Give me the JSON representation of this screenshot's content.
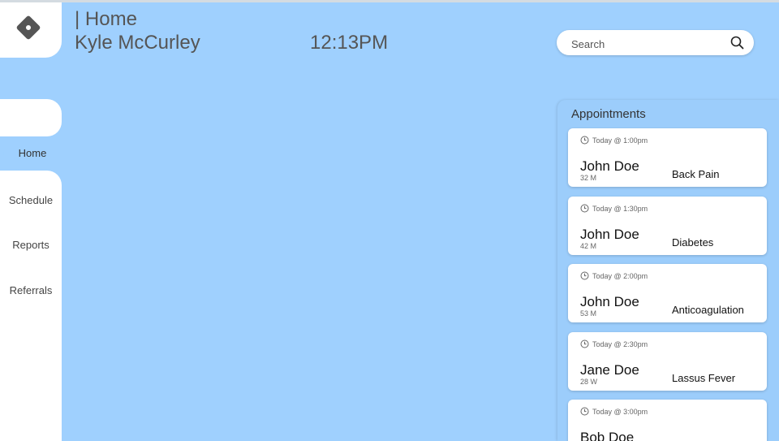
{
  "header": {
    "title": "| Home",
    "user": "Kyle McCurley",
    "time": "12:13PM"
  },
  "search": {
    "placeholder": "Search",
    "icon": "search-icon"
  },
  "sidebar": {
    "items": [
      {
        "label": "Home",
        "active": true
      },
      {
        "label": "Schedule",
        "active": false
      },
      {
        "label": "Reports",
        "active": false
      },
      {
        "label": "Referrals",
        "active": false
      }
    ]
  },
  "appointments": {
    "title": "Appointments",
    "items": [
      {
        "time": "Today @ 1:00pm",
        "name": "John Doe",
        "meta": "32 M",
        "reason": "Back Pain"
      },
      {
        "time": "Today @ 1:30pm",
        "name": "John Doe",
        "meta": "42 M",
        "reason": "Diabetes"
      },
      {
        "time": "Today @ 2:00pm",
        "name": "John Doe",
        "meta": "53 M",
        "reason": "Anticoagulation"
      },
      {
        "time": "Today @ 2:30pm",
        "name": "Jane Doe",
        "meta": "28 W",
        "reason": "Lassus Fever"
      },
      {
        "time": "Today @ 3:00pm",
        "name": "Bob Doe",
        "meta": "",
        "reason": ""
      }
    ]
  },
  "colors": {
    "background": "#9fd0fe",
    "card": "#ffffff",
    "logo": "#555555"
  }
}
